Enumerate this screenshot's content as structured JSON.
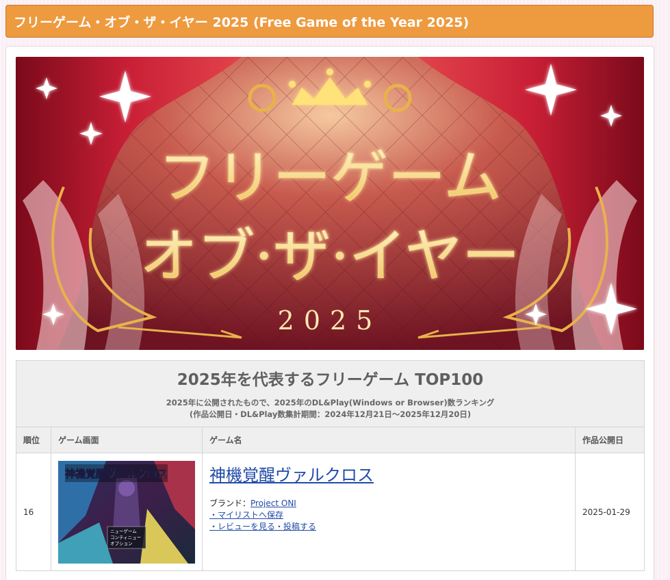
{
  "page": {
    "title": "フリーゲーム・オブ・ザ・イヤー 2025 (Free Game of the Year 2025)"
  },
  "banner": {
    "line1": "フリーゲーム",
    "line2": "オブ·ザ·イヤー",
    "year": "2025",
    "colors": {
      "curtain": "#b3152c",
      "gold": "#f6d77a",
      "bg": "#8c1f2c"
    }
  },
  "ranking": {
    "heading": "2025年を代表するフリーゲーム TOP100",
    "description": "2025年に公開されたもので、2025年のDL&Play(Windows or Browser)数ランキング",
    "period": "(作品公開日・DL&Play数集計期間：2024年12月21日〜2025年12月20日)",
    "columns": {
      "rank": "順位",
      "screen": "ゲーム画面",
      "name": "ゲーム名",
      "date": "作品公開日"
    },
    "rows": [
      {
        "rank": "16",
        "title": "神機覚醒ヴァルクロス",
        "brand_label": "ブランド：",
        "brand": "Project ONI",
        "mylist": "・マイリストへ保存",
        "review": "・レビューを見る・投稿する",
        "date": "2025-01-29",
        "thumb_title": "神機覚醒ヴァルクロス",
        "menu": [
          "ニューゲーム",
          "コンティニュー",
          "オプション"
        ]
      }
    ]
  }
}
